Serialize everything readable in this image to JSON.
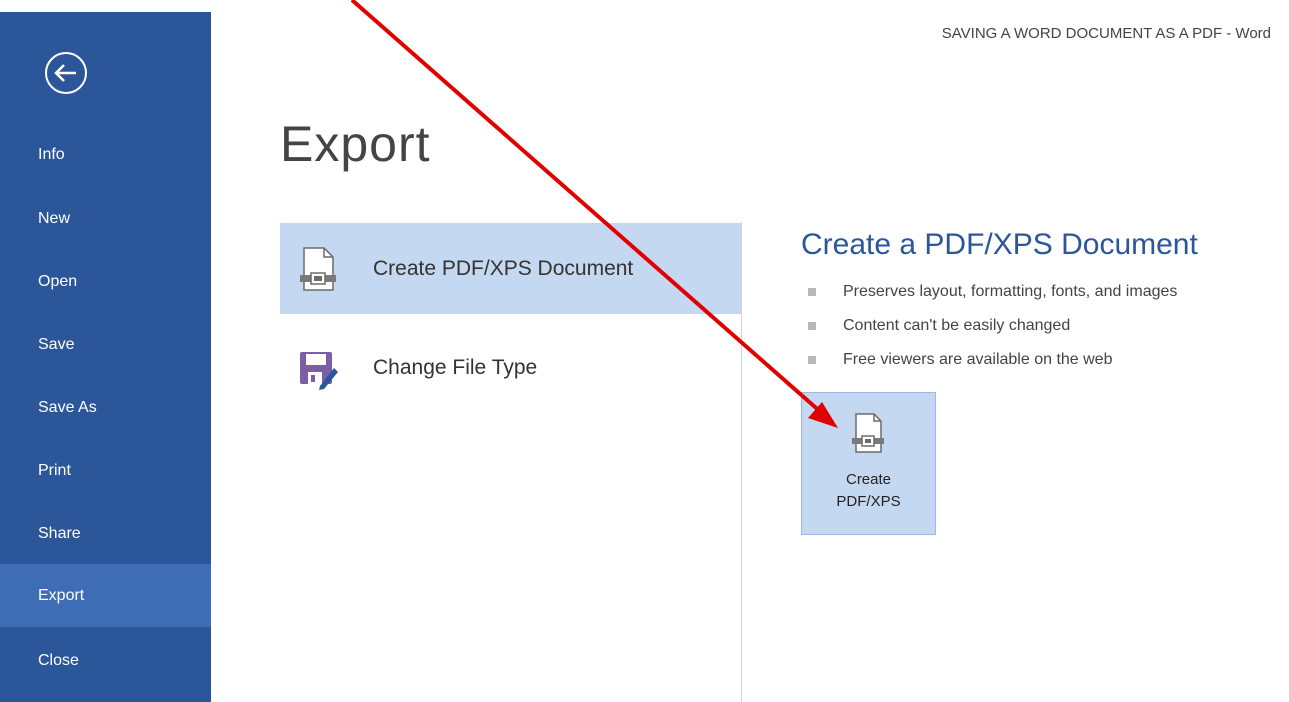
{
  "window": {
    "title": "SAVING A WORD DOCUMENT AS A PDF - Word"
  },
  "sidebar": {
    "back_icon": "back-arrow-icon",
    "items": [
      {
        "label": "Info",
        "active": false
      },
      {
        "label": "New",
        "active": false
      },
      {
        "label": "Open",
        "active": false
      },
      {
        "label": "Save",
        "active": false
      },
      {
        "label": "Save As",
        "active": false
      },
      {
        "label": "Print",
        "active": false
      },
      {
        "label": "Share",
        "active": false
      },
      {
        "label": "Export",
        "active": true
      },
      {
        "label": "Close",
        "active": false
      }
    ]
  },
  "main": {
    "title": "Export",
    "options": [
      {
        "label": "Create PDF/XPS Document",
        "icon": "pdf-document-icon",
        "selected": true
      },
      {
        "label": "Change File Type",
        "icon": "save-file-type-icon",
        "selected": false
      }
    ],
    "detail": {
      "title": "Create a PDF/XPS Document",
      "bullets": [
        "Preserves layout, formatting, fonts, and images",
        "Content can't be easily changed",
        "Free viewers are available on the web"
      ],
      "button": {
        "line1": "Create",
        "line2": "PDF/XPS",
        "icon": "pdf-document-icon"
      }
    }
  },
  "annotation": {
    "type": "red-arrow",
    "color": "#e00000"
  },
  "colors": {
    "sidebar": "#2b579a",
    "sidebar_active": "#3e6db5",
    "selection": "#c5d8f1",
    "accent_title": "#2b579a"
  }
}
